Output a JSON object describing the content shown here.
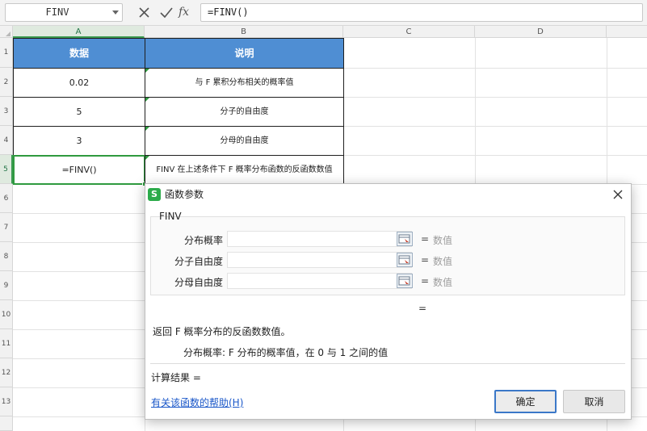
{
  "formula_bar": {
    "name_box": "FINV",
    "cancel_symbol": "✕",
    "enter_symbol": "✓",
    "fx_symbol": "fx",
    "formula": "=FINV()"
  },
  "columns": [
    "A",
    "B",
    "C",
    "D"
  ],
  "rows": [
    "1",
    "2",
    "3",
    "4",
    "5",
    "6",
    "7",
    "8",
    "9",
    "10",
    "11",
    "12",
    "13"
  ],
  "table": {
    "header": [
      "数据",
      "说明"
    ],
    "rows": [
      [
        "0.02",
        "与 F 累积分布相关的概率值"
      ],
      [
        "5",
        "分子的自由度"
      ],
      [
        "3",
        "分母的自由度"
      ],
      [
        "=FINV()",
        "FINV 在上述条件下 F 概率分布函数的反函数数值"
      ]
    ]
  },
  "dialog": {
    "title": "函数参数",
    "function_name": "FINV",
    "args": [
      {
        "label": "分布概率",
        "value": "",
        "type_hint": "数值"
      },
      {
        "label": "分子自由度",
        "value": "",
        "type_hint": "数值"
      },
      {
        "label": "分母自由度",
        "value": "",
        "type_hint": "数值"
      }
    ],
    "equals": "=",
    "result_equals": "=",
    "description": "返回 F 概率分布的反函数数值。",
    "param_desc": "分布概率:  F 分布的概率值，在 0 与 1 之间的值",
    "calc_result_label": "计算结果  =",
    "help_link": "有关该函数的帮助(H)",
    "ok_label": "确定",
    "cancel_label": "取消"
  },
  "colors": {
    "header_fill": "#4f8ed3",
    "selection_green": "#2f9a3f",
    "logo_green": "#2cab4b",
    "link_blue": "#1a57c9"
  }
}
